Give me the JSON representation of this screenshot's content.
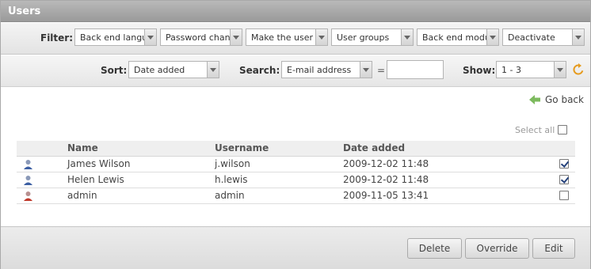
{
  "window": {
    "title": "Users"
  },
  "filter": {
    "label": "Filter:",
    "selects": [
      {
        "value": "Back end langua"
      },
      {
        "value": "Password chang"
      },
      {
        "value": "Make the user a"
      },
      {
        "value": "User groups"
      },
      {
        "value": "Back end module"
      },
      {
        "value": "Deactivate"
      }
    ]
  },
  "sort": {
    "label": "Sort:",
    "value": "Date added"
  },
  "search": {
    "label": "Search:",
    "field": "E-mail address",
    "operator": "=",
    "value": ""
  },
  "show": {
    "label": "Show:",
    "value": "1 - 3",
    "refresh_icon": "refresh-icon"
  },
  "go_back": {
    "label": "Go back",
    "icon": "arrow-left-icon"
  },
  "select_all": {
    "label": "Select all",
    "checked": false
  },
  "table": {
    "columns": [
      "Name",
      "Username",
      "Date added"
    ],
    "rows": [
      {
        "name": "James Wilson",
        "username": "j.wilson",
        "date": "2009-12-02 11:48",
        "checked": true,
        "icon": "user-icon",
        "icon_color": "#3c5fa3"
      },
      {
        "name": "Helen Lewis",
        "username": "h.lewis",
        "date": "2009-12-02 11:48",
        "checked": true,
        "icon": "user-icon",
        "icon_color": "#3c5fa3"
      },
      {
        "name": "admin",
        "username": "admin",
        "date": "2009-11-05 13:41",
        "checked": false,
        "icon": "admin-user-icon",
        "icon_color": "#c0392b"
      }
    ]
  },
  "buttons": {
    "delete": "Delete",
    "override": "Override",
    "edit": "Edit"
  },
  "colors": {
    "title_bar": "#a9a9a9",
    "go_back_arrow": "#6aa84f",
    "refresh": "#e69b1e"
  }
}
